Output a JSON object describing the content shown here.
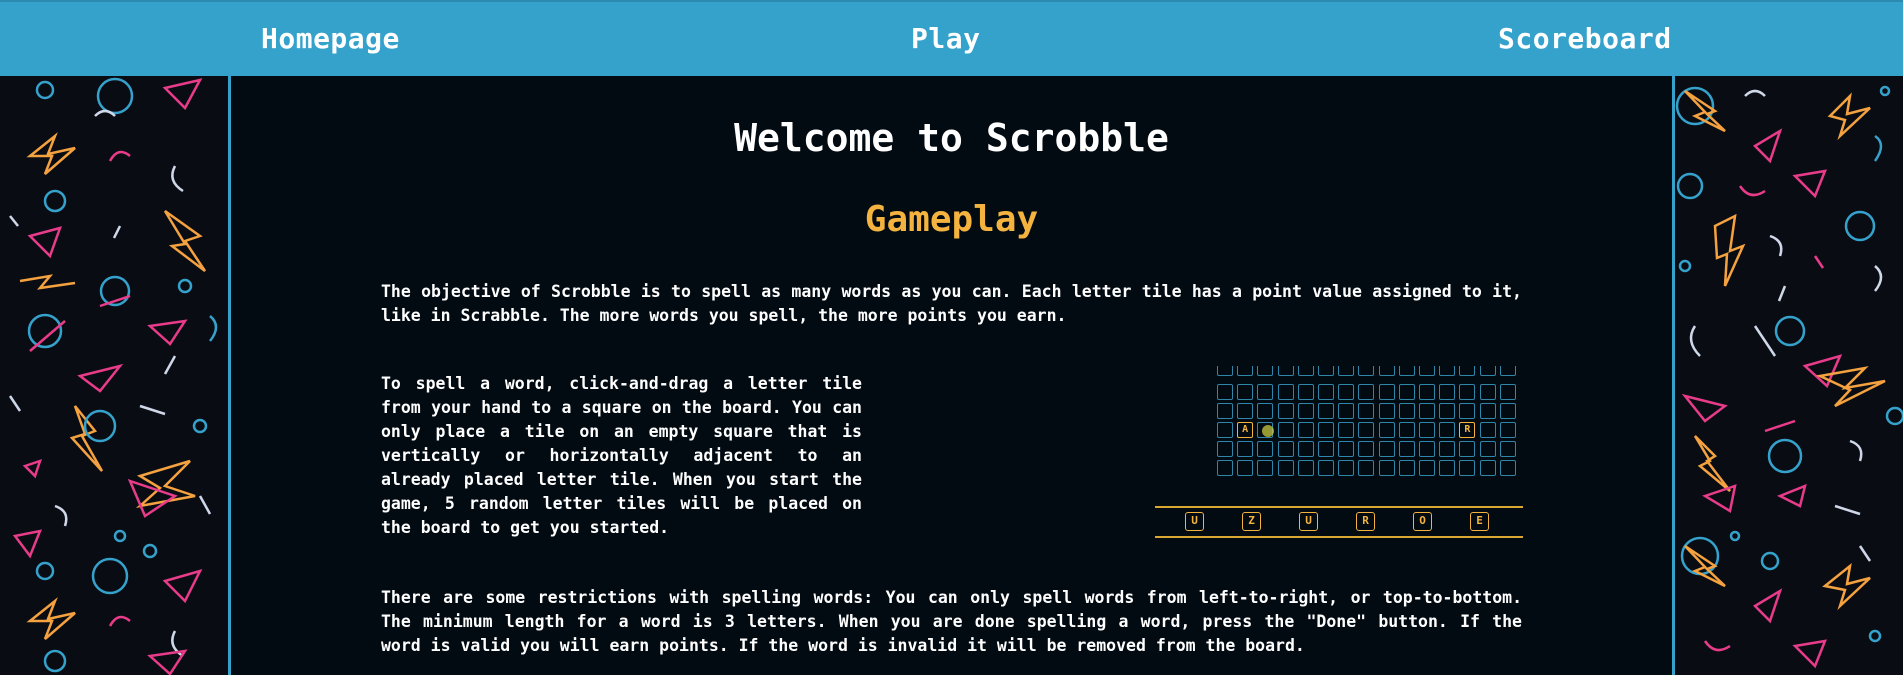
{
  "nav": {
    "homepage": "Homepage",
    "play": "Play",
    "scoreboard": "Scoreboard"
  },
  "main": {
    "title": "Welcome to Scrobble",
    "subtitle": "Gameplay",
    "paragraph1": "The objective of Scrobble is to spell as many words as you can. Each letter tile has a point value assigned to it, like in Scrabble. The more words you spell, the more points you earn.",
    "paragraph2": "To spell a word, click-and-drag a letter tile from your hand to a square on the board. You can only place a tile on an empty square that is vertically or horizontally adjacent to an already placed letter tile. When you start the game, 5 random letter tiles will be placed on the board to get you started.",
    "paragraph3": "There are some restrictions with spelling words: You can only spell words from left-to-right, or top-to-bottom. The minimum length for a word is 3 letters. When you are done spelling a word, press the \"Done\" button. If the word is valid you will earn points. If the word is invalid it will be removed from the board."
  },
  "illustration": {
    "board_placed": [
      {
        "row": 3,
        "col": 1,
        "letter": "A"
      },
      {
        "row": 3,
        "col": 12,
        "letter": "R"
      }
    ],
    "hand": [
      "U",
      "Z",
      "U",
      "R",
      "O",
      "E"
    ]
  },
  "colors": {
    "nav_bg": "#35a2cc",
    "accent_gold": "#f4b33f",
    "grid_blue": "#2f86a8",
    "page_bg": "#020a12"
  }
}
